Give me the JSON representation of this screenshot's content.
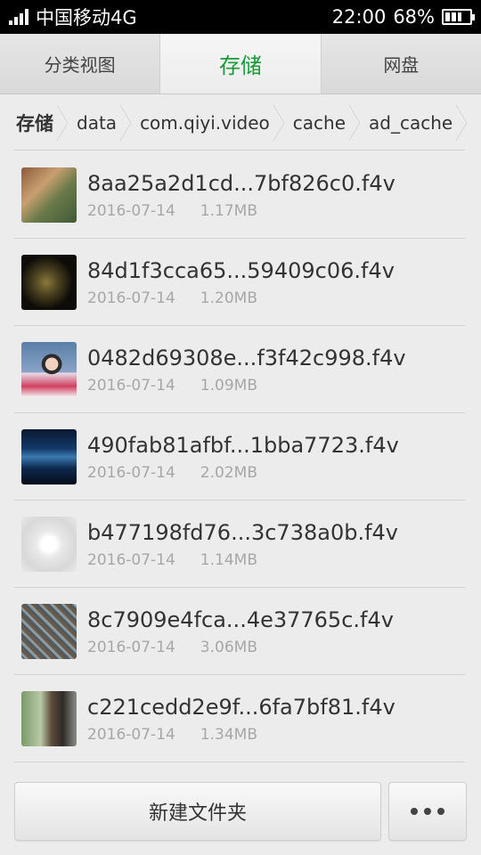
{
  "status_bar": {
    "carrier": "中国移动4G",
    "time": "22:00",
    "battery": "68%",
    "battery_level": 0.68
  },
  "tabs": [
    {
      "label": "分类视图",
      "active": false
    },
    {
      "label": "存储",
      "active": true
    },
    {
      "label": "网盘",
      "active": false
    }
  ],
  "breadcrumb": [
    "存储",
    "data",
    "com.qiyi.video",
    "cache",
    "ad_cache"
  ],
  "files": [
    {
      "name": "8aa25a2d1cd...7bf826c0.f4v",
      "date": "2016-07-14",
      "size": "1.17MB"
    },
    {
      "name": "84d1f3cca65...59409c06.f4v",
      "date": "2016-07-14",
      "size": "1.20MB"
    },
    {
      "name": "0482d69308e...f3f42c998.f4v",
      "date": "2016-07-14",
      "size": "1.09MB"
    },
    {
      "name": "490fab81afbf...1bba7723.f4v",
      "date": "2016-07-14",
      "size": "2.02MB"
    },
    {
      "name": "b477198fd76...3c738a0b.f4v",
      "date": "2016-07-14",
      "size": "1.14MB"
    },
    {
      "name": "8c7909e4fca...4e37765c.f4v",
      "date": "2016-07-14",
      "size": "3.06MB"
    },
    {
      "name": "c221cedd2e9f...6fa7bf81.f4v",
      "date": "2016-07-14",
      "size": "1.34MB"
    }
  ],
  "bottom": {
    "new_folder_label": "新建文件夹",
    "more_icon": "more-dots-icon"
  },
  "colors": {
    "accent": "#1a9a3a"
  }
}
